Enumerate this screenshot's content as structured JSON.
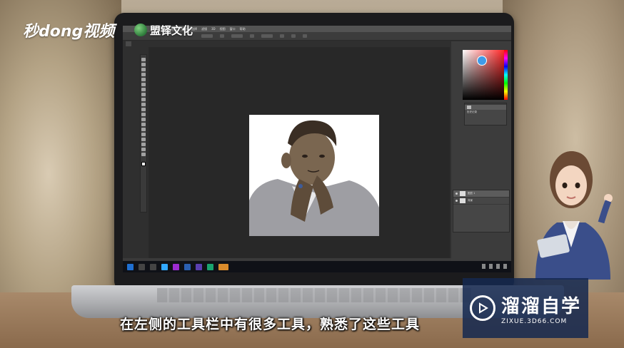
{
  "brand": {
    "logo_text": "秒dong视频",
    "partner_name": "盟铎文化"
  },
  "photoshop": {
    "menu_items": [
      "文件",
      "编辑",
      "图像",
      "图层",
      "文字",
      "选择",
      "滤镜",
      "3D",
      "视图",
      "窗口",
      "帮助"
    ],
    "history_items": [
      {
        "label": "历史记录"
      }
    ],
    "layers": [
      {
        "label": "图层 1",
        "selected": true
      },
      {
        "label": "背景",
        "selected": false
      }
    ]
  },
  "subtitle": "在左侧的工具栏中有很多工具，熟悉了这些工具",
  "watermark": {
    "title": "溜溜自学",
    "url": "ZIXUE.3D66.COM"
  },
  "colors": {
    "accent_blue": "#3e9be8",
    "watermark_bg": "#142850"
  }
}
